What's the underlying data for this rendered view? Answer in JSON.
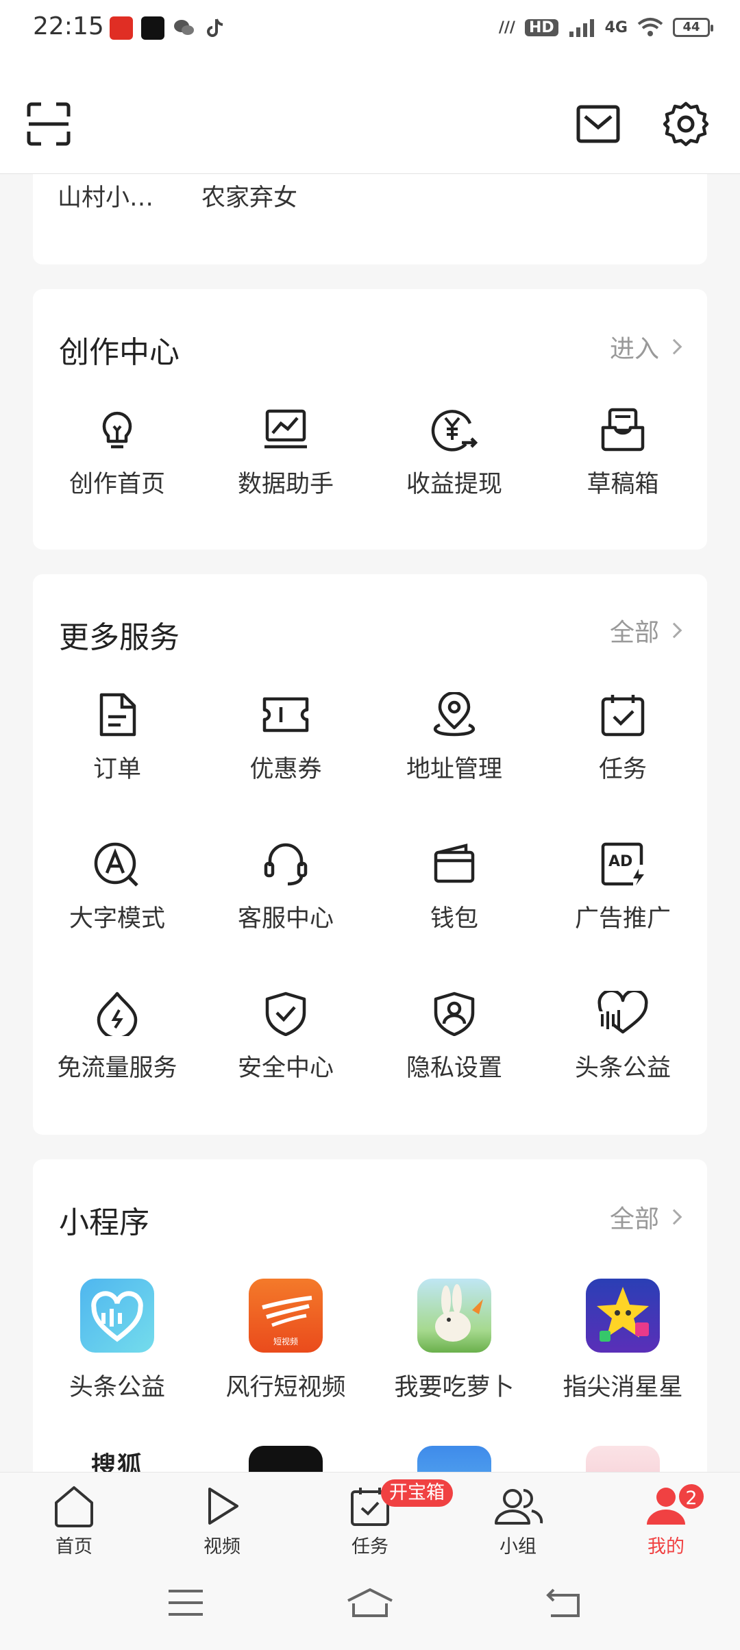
{
  "status_bar": {
    "time": "22:15",
    "icons": [
      "pinduoduo-icon",
      "douyin-icon",
      "wechat-icon",
      "tiktok-icon"
    ],
    "network": "4G",
    "battery": "44"
  },
  "top_bar": {
    "scan_icon": "scan-icon",
    "message_icon": "mail-icon",
    "settings_icon": "gear-icon"
  },
  "recent_reads": {
    "items": [
      "山村小…",
      "农家弃女"
    ]
  },
  "creation_center": {
    "title": "创作中心",
    "more_label": "进入",
    "items": [
      {
        "label": "创作首页",
        "icon": "lightbulb-icon"
      },
      {
        "label": "数据助手",
        "icon": "data-chart-icon"
      },
      {
        "label": "收益提现",
        "icon": "yuan-withdraw-icon"
      },
      {
        "label": "草稿箱",
        "icon": "draft-box-icon"
      }
    ]
  },
  "more_services": {
    "title": "更多服务",
    "more_label": "全部",
    "items": [
      {
        "label": "订单",
        "icon": "order-icon"
      },
      {
        "label": "优惠券",
        "icon": "coupon-icon"
      },
      {
        "label": "地址管理",
        "icon": "location-icon"
      },
      {
        "label": "任务",
        "icon": "task-icon"
      },
      {
        "label": "大字模式",
        "icon": "large-font-icon"
      },
      {
        "label": "客服中心",
        "icon": "headset-icon"
      },
      {
        "label": "钱包",
        "icon": "wallet-icon"
      },
      {
        "label": "广告推广",
        "icon": "ad-icon"
      },
      {
        "label": "免流量服务",
        "icon": "free-data-icon"
      },
      {
        "label": "安全中心",
        "icon": "shield-check-icon"
      },
      {
        "label": "隐私设置",
        "icon": "privacy-shield-icon"
      },
      {
        "label": "头条公益",
        "icon": "charity-heart-icon"
      }
    ]
  },
  "mini_programs": {
    "title": "小程序",
    "more_label": "全部",
    "items": [
      {
        "label": "头条公益",
        "color": "#5ec8ee"
      },
      {
        "label": "风行短视频",
        "color": "#f15a22"
      },
      {
        "label": "我要吃萝卜",
        "color": "#9fd3a0"
      },
      {
        "label": "指尖消星星",
        "color": "#3552c8"
      }
    ],
    "partial_row": [
      "搜狐"
    ]
  },
  "bottom_nav": {
    "items": [
      {
        "label": "首页"
      },
      {
        "label": "视频"
      },
      {
        "label": "任务"
      },
      {
        "label": "小组"
      },
      {
        "label": "我的"
      }
    ],
    "task_badge": "开宝箱",
    "mine_badge": "2",
    "active_color": "#f04142"
  }
}
